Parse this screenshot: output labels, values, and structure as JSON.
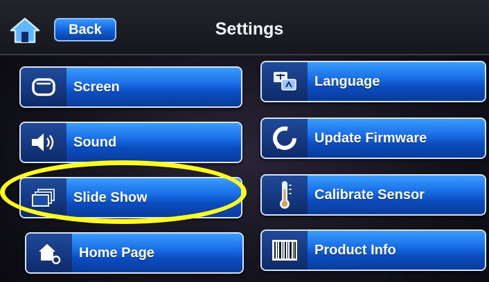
{
  "header": {
    "back_label": "Back",
    "title": "Settings"
  },
  "menu": {
    "left": [
      {
        "label": "Screen",
        "icon": "screen-icon"
      },
      {
        "label": "Sound",
        "icon": "speaker-icon"
      },
      {
        "label": "Slide Show",
        "icon": "slideshow-icon"
      },
      {
        "label": "Home Page",
        "icon": "home-gear-icon"
      }
    ],
    "right": [
      {
        "label": "Language",
        "icon": "language-icon"
      },
      {
        "label": "Update Firmware",
        "icon": "update-icon"
      },
      {
        "label": "Calibrate Sensor",
        "icon": "thermometer-icon"
      },
      {
        "label": "Product Info",
        "icon": "barcode-icon"
      }
    ]
  },
  "highlight": {
    "target": "Slide Show",
    "color": "#ffff1a"
  },
  "colors": {
    "accent": "#1a6fe6",
    "tile_border": "#d7e6ff",
    "header_bg": "#1c1e24"
  }
}
